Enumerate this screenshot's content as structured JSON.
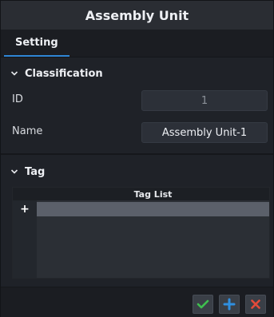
{
  "window": {
    "title": "Assembly Unit"
  },
  "tabs": [
    {
      "label": "Setting",
      "active": true
    }
  ],
  "sections": {
    "classification": {
      "title": "Classification",
      "fields": {
        "id": {
          "label": "ID",
          "value": "1"
        },
        "name": {
          "label": "Name",
          "value": "Assembly Unit-1"
        }
      }
    },
    "tag": {
      "title": "Tag",
      "table": {
        "header": "Tag List",
        "add_glyph": "+"
      }
    }
  },
  "footer": {
    "buttons": [
      {
        "icon": "check-icon",
        "color": "#3fbf4f"
      },
      {
        "icon": "plus-icon",
        "color": "#2f8fe0"
      },
      {
        "icon": "close-icon",
        "color": "#e24a3a"
      }
    ]
  }
}
